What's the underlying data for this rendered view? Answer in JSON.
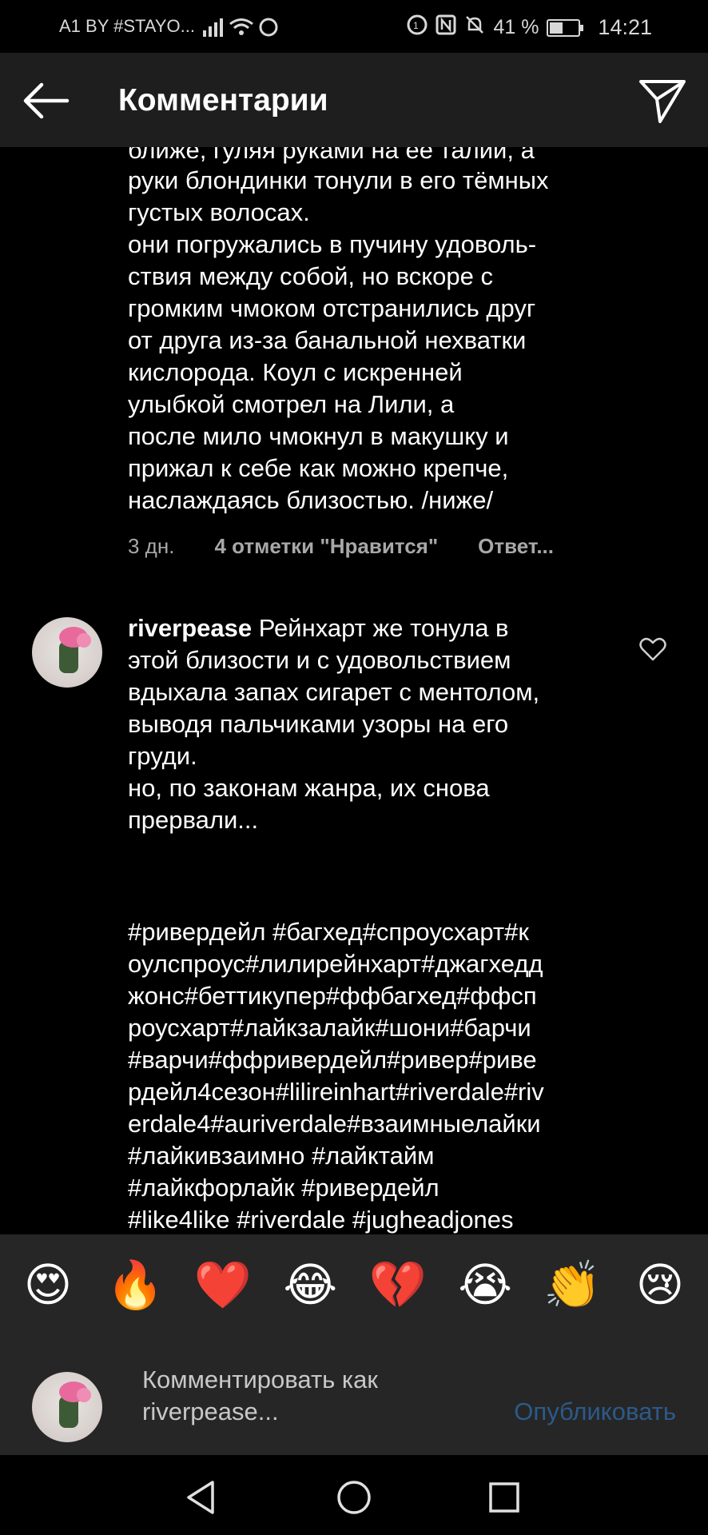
{
  "status": {
    "carrier": "A1 BY #STAYO...",
    "battery": "41 %",
    "battery_level": 0.41,
    "time": "14:21"
  },
  "header": {
    "title": "Комментарии"
  },
  "comments": [
    {
      "partial_first_line": "ближе, гуляя руками на её талии, а",
      "text": "руки блондинки тонули в его тёмных\nгустых волосах.\nони погружались в пучину удоволь-\nствия между собой, но вскоре с\nгромким чмоком отстранились друг\nот друга из-за банальной нехватки\nкислорода. Коул с искренней\nулыбкой смотрел на Лили, а\nпосле мило чмокнул в макушку и\nприжал к себе как можно крепче,\nнаслаждаясь близостью. /ниже/",
      "time": "3 дн.",
      "likes": "4 отметки \"Нравится\"",
      "reply": "Ответ..."
    },
    {
      "username": "riverpease",
      "text": " Рейнхарт же тонула в\nэтой близости и с удовольствием\nвдыхала запах сигарет с ментолом,\nвыводя пальчиками узоры на его\nгруди.\nно, по законам жанра, их снова\nпрервали...",
      "hashtags": "#ривердейл #багхед#спроусхарт#к\nоулспроус#лилирейнхарт#джагхедд\nжонс#беттикупер#ффбагхед#ффсп\nроусхарт#лайкзалайк#шони#барчи\n#варчи#ффривердейл#ривер#риве\nрдейл4сезон#lilireinhart#riverdale#riv\nerdale4#auriverdale#взаимныелайки\n#лайкивзаимно #лайктайм\n#лайкфорлайк #ривердейл\n#like4like #riverdale #jugheadjones"
    }
  ],
  "emoji_bar": [
    "😍",
    "🔥",
    "❤️",
    "😂",
    "💔",
    "😭",
    "👏",
    "😢"
  ],
  "input": {
    "placeholder": "Комментировать как riverpease...",
    "publish_label": "Опубликовать"
  }
}
